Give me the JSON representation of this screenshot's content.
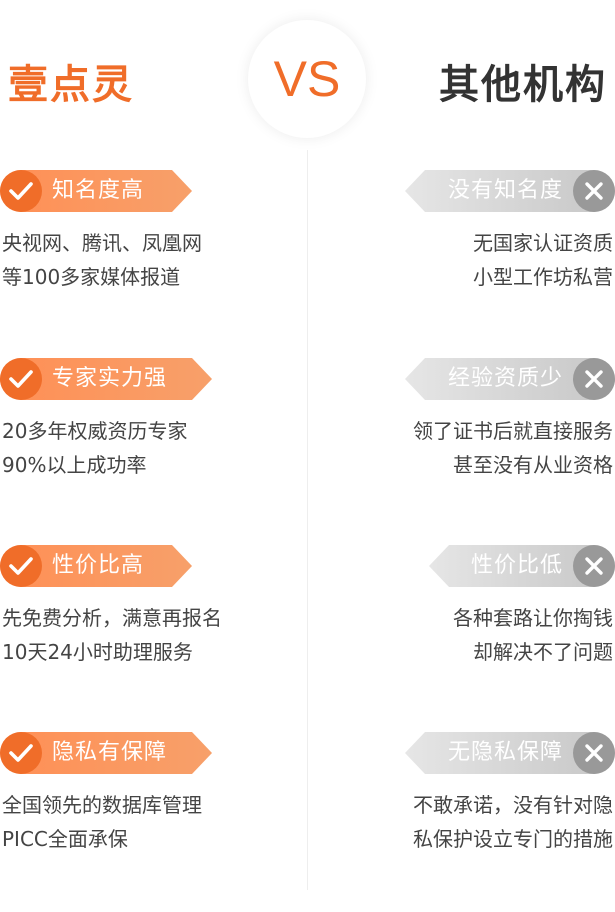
{
  "header": {
    "left_brand": "壹点灵",
    "vs": "VS",
    "right_brand": "其他机构"
  },
  "colors": {
    "accent": "#f06d29",
    "gray": "#999999"
  },
  "rows": [
    {
      "left_badge": "知名度高",
      "left_lines": [
        "央视网、腾讯、凤凰网",
        "等100多家媒体报道"
      ],
      "right_badge": "没有知名度",
      "right_lines": [
        "无国家认证资质",
        "小型工作坊私营"
      ]
    },
    {
      "left_badge": "专家实力强",
      "left_lines": [
        "20多年权威资历专家",
        "90%以上成功率"
      ],
      "right_badge": "经验资质少",
      "right_lines": [
        "领了证书后就直接服务",
        "甚至没有从业资格"
      ]
    },
    {
      "left_badge": "性价比高",
      "left_lines": [
        "先免费分析，满意再报名",
        "10天24小时助理服务"
      ],
      "right_badge": "性价比低",
      "right_lines": [
        "各种套路让你掏钱",
        "却解决不了问题"
      ]
    },
    {
      "left_badge": "隐私有保障",
      "left_lines": [
        "全国领先的数据库管理",
        "PICC全面承保"
      ],
      "right_badge": "无隐私保障",
      "right_lines": [
        "不敢承诺，没有针对隐",
        "私保护设立专门的措施"
      ]
    }
  ]
}
